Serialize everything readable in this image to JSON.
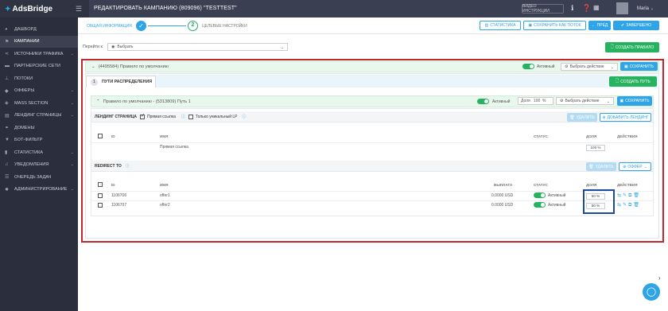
{
  "topbar": {
    "brand": "AdsBridge",
    "campaign_title": "РЕДАКТИРОВАТЬ КАМПАНИЮ (809096) \"TESTTEST\"",
    "video_label": "ВИДЕО ИНСТРУКЦИИ",
    "user_name": "Maria"
  },
  "sidebar": {
    "items": [
      {
        "label": "ДАШБОРД",
        "icon": "dashboard-icon",
        "has_arrow": false
      },
      {
        "label": "КАМПАНИИ",
        "icon": "flag-icon",
        "has_arrow": false,
        "active": true
      },
      {
        "label": "ИСТОЧНИКИ ТРАФИКА",
        "icon": "share-icon",
        "has_arrow": true
      },
      {
        "label": "ПАРТНЕРСКИЕ СЕТИ",
        "icon": "briefcase-icon",
        "has_arrow": false
      },
      {
        "label": "ПОТОКИ",
        "icon": "sitemap-icon",
        "has_arrow": false
      },
      {
        "label": "ОФФЕРЫ",
        "icon": "tag-icon",
        "has_arrow": true
      },
      {
        "label": "MASS SECTION",
        "icon": "tags-icon",
        "has_arrow": true
      },
      {
        "label": "ЛЕНДИНГ СТРАНИЦЫ",
        "icon": "page-icon",
        "has_arrow": true
      },
      {
        "label": "ДОМЕНЫ",
        "icon": "link-icon",
        "has_arrow": false
      },
      {
        "label": "БОТ-ФИЛЬТР",
        "icon": "filter-icon",
        "has_arrow": false
      },
      {
        "label": "СТАТИСТИКА",
        "icon": "bar-chart-icon",
        "has_arrow": true
      },
      {
        "label": "УВЕДОМЛЕНИЯ",
        "icon": "bell-icon",
        "has_arrow": true
      },
      {
        "label": "ОЧЕРЕДЬ ЗАДАЧ",
        "icon": "list-icon",
        "has_arrow": false
      },
      {
        "label": "АДМИНИСТРИРОВАНИЕ",
        "icon": "gear-icon",
        "has_arrow": true
      }
    ]
  },
  "steps": {
    "step1": "ОБЩАЯ ИНФОРМАЦИЯ",
    "step2_num": "2",
    "step2": "ЦЕЛЕВЫЕ НАСТРОЙКИ"
  },
  "actions": {
    "stats": "СТАТИСТИКА",
    "save_as_flow": "СОХРАНИТЬ КАК ПОТОК",
    "prev": "ПРЕД",
    "finish": "ЗАВЕРШЕНО",
    "create_rule": "СОЗДАТЬ ПРАВИЛО"
  },
  "goto": {
    "label": "Перейти к",
    "placeholder": "Выбрать"
  },
  "rule": {
    "title": "(4495584) Правило по умолчанию",
    "active_label": "Активный",
    "action_select": "Выбрать действие",
    "save": "СОХРАНИТЬ"
  },
  "tabs": {
    "num": "1",
    "label": "ПУТИ РАСПРЕДЕЛЕНИЯ",
    "create_path": "СОЗДАТЬ ПУТЬ"
  },
  "path": {
    "title": "Правило по умолчанию - (5313809) Путь 1",
    "active_label": "Активный",
    "share_label": "Доля",
    "share_value": "100",
    "share_unit": "%",
    "action_select": "Выбрать действие",
    "save": "СОХРАНИТЬ"
  },
  "landing": {
    "section": "ЛЕНДИНГ СТРАНИЦА",
    "direct_link": "Прямая ссылка",
    "unique_lp": "Только уникальный LP",
    "delete": "УДАЛИТЬ",
    "add_landing": "ДОБАВИТЬ ЛЕНДИНГ",
    "columns": {
      "id": "ID",
      "name": "ИМЯ",
      "status": "СТАТУС",
      "share": "ДОЛЯ",
      "actions": "ДЕЙСТВИЯ"
    },
    "rows": [
      {
        "id": "",
        "name": "Прямая ссылка",
        "share": "100 %"
      }
    ]
  },
  "redirect": {
    "section": "REDIRECT TO",
    "delete": "УДАЛИТЬ",
    "offer": "ОФФЕР",
    "columns": {
      "id": "ID",
      "name": "ИМЯ",
      "payout": "ВЫПЛАТА",
      "status": "СТАТУС",
      "share": "ДОЛЯ",
      "actions": "ДЕЙСТВИЯ"
    },
    "rows": [
      {
        "id": "1106706",
        "name": "offer1",
        "payout": "0.0000 USD",
        "status": "Активный",
        "share": "50 %"
      },
      {
        "id": "1106707",
        "name": "offer2",
        "payout": "0.0000 USD",
        "status": "Активный",
        "share": "50 %"
      }
    ]
  },
  "colors": {
    "accent": "#2fa4e7",
    "green": "#27b25f",
    "highlight_red": "#c0282d",
    "highlight_blue": "#1d4aa0"
  }
}
